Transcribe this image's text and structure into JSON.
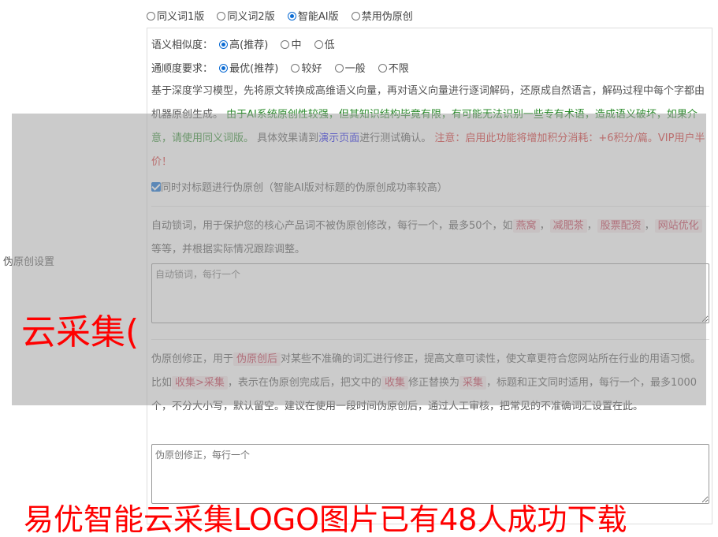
{
  "modes": {
    "options": [
      "同义词1版",
      "同义词2版",
      "智能AI版",
      "禁用伪原创"
    ],
    "selected": 2
  },
  "setting_label": "伪原创设置",
  "similarity": {
    "label": "语义相似度：",
    "options": [
      "高(推荐)",
      "中",
      "低"
    ],
    "selected": 0
  },
  "fluency": {
    "label": "通顺度要求：",
    "options": [
      "最优(推荐)",
      "较好",
      "一般",
      "不限"
    ],
    "selected": 0
  },
  "description": {
    "p1": "基于深度学习模型，先将原文转换成高维语义向量，再对语义向量进行逐词解码，还原成自然语言，解码过程中每个字都由机器原创生成。",
    "p2_green": "由于AI系统原创性较强，但其知识结构毕竟有限，有可能无法识别一些专有术语，造成语义破坏，如果介意，请使用同义词版。",
    "p3": "具体效果请到",
    "p3_link": "演示页面",
    "p3_tail": "进行测试确认。",
    "p4_red": "注意：启用此功能将增加积分消耗：+6积分/篇。VIP用户半价！"
  },
  "title_checkbox": {
    "checked": true,
    "label": "同时对标题进行伪原创（智能AI版对标题的伪原创成功率较高）"
  },
  "lock_words": {
    "text_a": "自动锁词，用于保护您的核心产品词不被伪原创修改，每行一个，最多50个，如",
    "tags": [
      "燕窝",
      "减肥茶",
      "股票配资",
      "网站优化"
    ],
    "text_b": "等等，并根据实际情况跟踪调整。",
    "placeholder": "自动锁词，每行一个"
  },
  "correction": {
    "text_a": "伪原创修正，用于",
    "tag1": "伪原创后",
    "text_b": "对某些不准确的词汇进行修正，提高文章可读性，使文章更符合您网站所在行业的用语习惯。比如",
    "tag2": "收集>采集",
    "text_c": "，表示在伪原创完成后，把文中的",
    "tag3": "收集",
    "text_d": "修正替换为",
    "tag4": "采集",
    "text_e": "，标题和正文同时适用，每行一个，最多1000个，不分大小写，默认留空。建议在使用一段时间伪原创后，通过人工审核，把常见的不准确词汇设置在此。",
    "placeholder": "伪原创修正，每行一个"
  },
  "watermark": {
    "line1": "云采集(",
    "line2": "易优智能云采集LOGO图片已有48人成功下载"
  },
  "colors": {
    "accent": "#0b6bd3",
    "green": "#2a8a2a",
    "red": "#d93030",
    "link": "#1a1aee"
  }
}
